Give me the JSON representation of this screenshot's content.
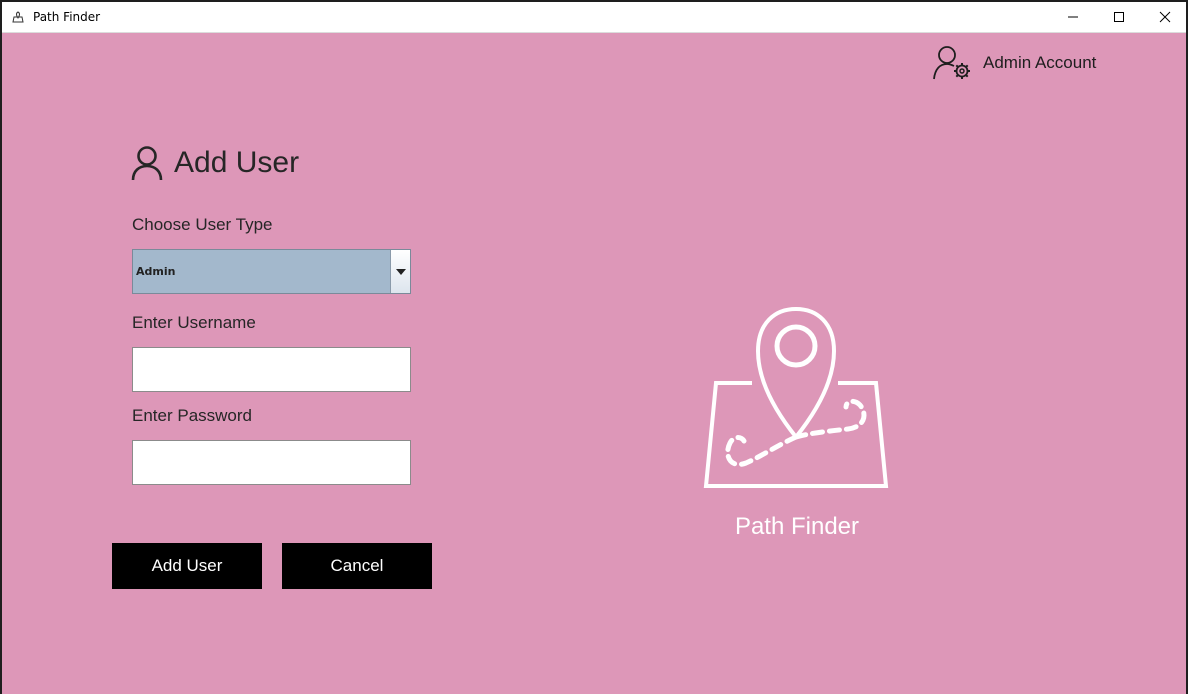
{
  "window": {
    "title": "Path Finder",
    "controls": {
      "minimize": "minimize",
      "maximize": "maximize",
      "close": "close"
    }
  },
  "header": {
    "account_label": "Admin Account",
    "account_icon": "user-gear-icon"
  },
  "form": {
    "title": "Add User",
    "title_icon": "user-icon",
    "user_type_label": "Choose User Type",
    "user_type_value": "Admin",
    "username_label": "Enter Username",
    "username_value": "",
    "password_label": "Enter Password",
    "password_value": "",
    "add_button": "Add User",
    "cancel_button": "Cancel"
  },
  "brand": {
    "label": "Path Finder",
    "icon": "map-pin-icon"
  },
  "colors": {
    "background": "#dd97b8",
    "combo": "#a3b8cc",
    "button": "#000000",
    "brand_text": "#ffffff"
  }
}
